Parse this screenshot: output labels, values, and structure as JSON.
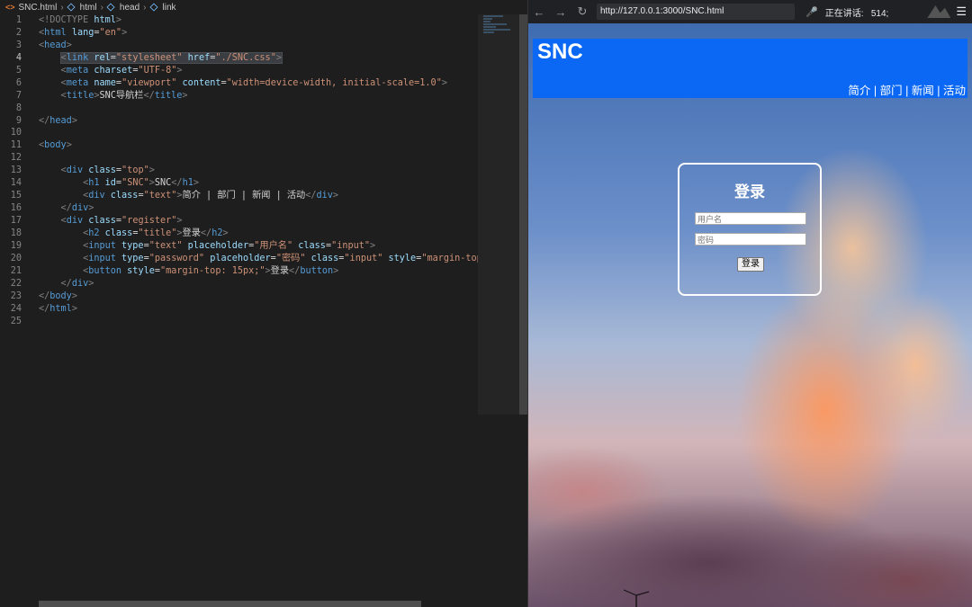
{
  "editor": {
    "breadcrumb": {
      "file": "SNC.html",
      "crumbs": [
        "html",
        "head",
        "link"
      ]
    },
    "lines": [
      {
        "n": "1",
        "html": "<span class=\"t\">&lt;!DOCTYPE</span> <span class=\"at\">html</span><span class=\"t\">&gt;</span>"
      },
      {
        "n": "2",
        "html": "<span class=\"t\">&lt;</span><span class=\"tg\">html</span> <span class=\"at\">lang</span><span class=\"tx\">=</span><span class=\"st\">\"en\"</span><span class=\"t\">&gt;</span>"
      },
      {
        "n": "3",
        "html": "<span class=\"t\">&lt;</span><span class=\"tg\">head</span><span class=\"t\">&gt;</span>"
      },
      {
        "n": "4",
        "html": "    <span class=\"txt-hl\"><span class=\"t\">&lt;</span><span class=\"tg\">link</span> <span class=\"at\">rel</span><span class=\"tx\">=</span><span class=\"st\">\"stylesheet\"</span> <span class=\"at\">href</span><span class=\"tx\">=</span><span class=\"st\">\"./SNC.css\"</span><span class=\"t\">&gt;</span></span>",
        "hl": true
      },
      {
        "n": "5",
        "html": "    <span class=\"t\">&lt;</span><span class=\"tg\">meta</span> <span class=\"at\">charset</span><span class=\"tx\">=</span><span class=\"st\">\"UTF-8\"</span><span class=\"t\">&gt;</span>"
      },
      {
        "n": "6",
        "html": "    <span class=\"t\">&lt;</span><span class=\"tg\">meta</span> <span class=\"at\">name</span><span class=\"tx\">=</span><span class=\"st\">\"viewport\"</span> <span class=\"at\">content</span><span class=\"tx\">=</span><span class=\"st\">\"width=device-width, initial-scale=1.0\"</span><span class=\"t\">&gt;</span>"
      },
      {
        "n": "7",
        "html": "    <span class=\"t\">&lt;</span><span class=\"tg\">title</span><span class=\"t\">&gt;</span><span class=\"tx\">SNC导航栏</span><span class=\"t\">&lt;/</span><span class=\"tg\">title</span><span class=\"t\">&gt;</span>"
      },
      {
        "n": "8",
        "html": ""
      },
      {
        "n": "9",
        "html": "<span class=\"t\">&lt;/</span><span class=\"tg\">head</span><span class=\"t\">&gt;</span>"
      },
      {
        "n": "10",
        "html": ""
      },
      {
        "n": "11",
        "html": "<span class=\"t\">&lt;</span><span class=\"tg\">body</span><span class=\"t\">&gt;</span>"
      },
      {
        "n": "12",
        "html": ""
      },
      {
        "n": "13",
        "html": "    <span class=\"t\">&lt;</span><span class=\"tg\">div</span> <span class=\"at\">class</span><span class=\"tx\">=</span><span class=\"st\">\"top\"</span><span class=\"t\">&gt;</span>"
      },
      {
        "n": "14",
        "html": "        <span class=\"t\">&lt;</span><span class=\"tg\">h1</span> <span class=\"at\">id</span><span class=\"tx\">=</span><span class=\"st\">\"SNC\"</span><span class=\"t\">&gt;</span><span class=\"tx\">SNC</span><span class=\"t\">&lt;/</span><span class=\"tg\">h1</span><span class=\"t\">&gt;</span>"
      },
      {
        "n": "15",
        "html": "        <span class=\"t\">&lt;</span><span class=\"tg\">div</span> <span class=\"at\">class</span><span class=\"tx\">=</span><span class=\"st\">\"text\"</span><span class=\"t\">&gt;</span><span class=\"tx\">简介 | 部门 | 新闻 | 活动</span><span class=\"t\">&lt;/</span><span class=\"tg\">div</span><span class=\"t\">&gt;</span>"
      },
      {
        "n": "16",
        "html": "    <span class=\"t\">&lt;/</span><span class=\"tg\">div</span><span class=\"t\">&gt;</span>"
      },
      {
        "n": "17",
        "html": "    <span class=\"t\">&lt;</span><span class=\"tg\">div</span> <span class=\"at\">class</span><span class=\"tx\">=</span><span class=\"st\">\"register\"</span><span class=\"t\">&gt;</span>"
      },
      {
        "n": "18",
        "html": "        <span class=\"t\">&lt;</span><span class=\"tg\">h2</span> <span class=\"at\">class</span><span class=\"tx\">=</span><span class=\"st\">\"title\"</span><span class=\"t\">&gt;</span><span class=\"tx\">登录</span><span class=\"t\">&lt;/</span><span class=\"tg\">h2</span><span class=\"t\">&gt;</span>"
      },
      {
        "n": "19",
        "html": "        <span class=\"t\">&lt;</span><span class=\"tg\">input</span> <span class=\"at\">type</span><span class=\"tx\">=</span><span class=\"st\">\"text\"</span> <span class=\"at\">placeholder</span><span class=\"tx\">=</span><span class=\"st\">\"用户名\"</span> <span class=\"at\">class</span><span class=\"tx\">=</span><span class=\"st\">\"input\"</span><span class=\"t\">&gt;</span>"
      },
      {
        "n": "20",
        "html": "        <span class=\"t\">&lt;</span><span class=\"tg\">input</span> <span class=\"at\">type</span><span class=\"tx\">=</span><span class=\"st\">\"password\"</span> <span class=\"at\">placeholder</span><span class=\"tx\">=</span><span class=\"st\">\"密码\"</span> <span class=\"at\">class</span><span class=\"tx\">=</span><span class=\"st\">\"input\"</span> <span class=\"at\">style</span><span class=\"tx\">=</span><span class=\"st\">\"margin-top:</span>"
      },
      {
        "n": "21",
        "html": "        <span class=\"t\">&lt;</span><span class=\"tg\">button</span> <span class=\"at\">style</span><span class=\"tx\">=</span><span class=\"st\">\"margin-top: 15px;\"</span><span class=\"t\">&gt;</span><span class=\"tx\">登录</span><span class=\"t\">&lt;/</span><span class=\"tg\">button</span><span class=\"t\">&gt;</span>"
      },
      {
        "n": "22",
        "html": "    <span class=\"t\">&lt;/</span><span class=\"tg\">div</span><span class=\"t\">&gt;</span>"
      },
      {
        "n": "23",
        "html": "<span class=\"t\">&lt;/</span><span class=\"tg\">body</span><span class=\"t\">&gt;</span>"
      },
      {
        "n": "24",
        "html": "<span class=\"t\">&lt;/</span><span class=\"tg\">html</span><span class=\"t\">&gt;</span>"
      },
      {
        "n": "25",
        "html": ""
      }
    ]
  },
  "browser": {
    "back": "←",
    "forward": "→",
    "reload": "↻",
    "url": "http://127.0.0.1:3000/SNC.html",
    "mic": "🎤",
    "speaking_label": "正在讲话:   514;",
    "menu": "☰"
  },
  "page": {
    "site_title": "SNC",
    "nav_text": "简介 | 部门 | 新闻 | 活动",
    "register_title": "登录",
    "username_placeholder": "用户名",
    "password_placeholder": "密码",
    "login_button": "登录"
  },
  "colors": {
    "top_bar": "#0a68f5",
    "editor_bg": "#1e1e1e"
  }
}
